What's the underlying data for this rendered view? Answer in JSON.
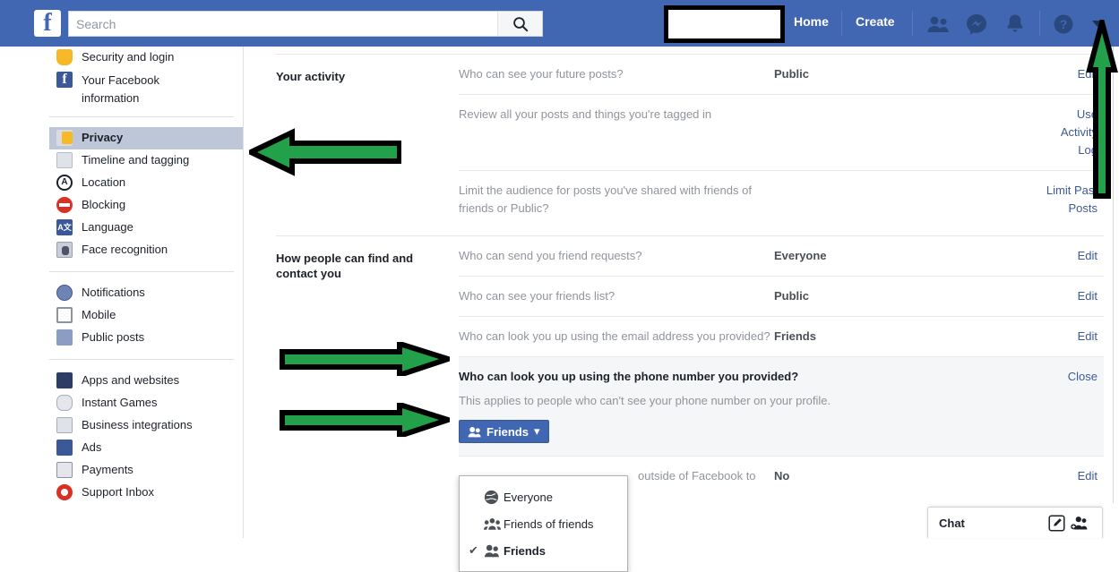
{
  "topbar": {
    "logo": "f",
    "search": {
      "placeholder": "Search",
      "value": "",
      "icon": "search-icon"
    },
    "redacted_account_name": "",
    "home_label": "Home",
    "create_label": "Create",
    "icons": [
      "friend-requests-icon",
      "messenger-icon",
      "notifications-icon",
      "help-icon",
      "account-menu-caret-icon"
    ],
    "brand_color": "#4267b2"
  },
  "sidebar": {
    "groups": [
      {
        "items": [
          {
            "label": "Security and login",
            "icon": "shield-icon",
            "active": false
          },
          {
            "label": "Your Facebook information",
            "icon": "facebook-icon",
            "active": false,
            "two_line": true
          }
        ]
      },
      {
        "items": [
          {
            "label": "Privacy",
            "icon": "lock-icon",
            "active": true
          },
          {
            "label": "Timeline and tagging",
            "icon": "timeline-icon",
            "active": false
          },
          {
            "label": "Location",
            "icon": "location-icon",
            "active": false
          },
          {
            "label": "Blocking",
            "icon": "block-icon",
            "active": false
          },
          {
            "label": "Language",
            "icon": "language-icon",
            "active": false
          },
          {
            "label": "Face recognition",
            "icon": "face-recognition-icon",
            "active": false
          }
        ]
      },
      {
        "items": [
          {
            "label": "Notifications",
            "icon": "globe-icon",
            "active": false
          },
          {
            "label": "Mobile",
            "icon": "mobile-icon",
            "active": false
          },
          {
            "label": "Public posts",
            "icon": "rss-icon",
            "active": false
          }
        ]
      },
      {
        "items": [
          {
            "label": "Apps and websites",
            "icon": "apps-icon",
            "active": false
          },
          {
            "label": "Instant Games",
            "icon": "gamepad-icon",
            "active": false
          },
          {
            "label": "Business integrations",
            "icon": "business-gear-icon",
            "active": false
          },
          {
            "label": "Ads",
            "icon": "ads-icon",
            "active": false
          },
          {
            "label": "Payments",
            "icon": "payments-card-icon",
            "active": false
          },
          {
            "label": "Support Inbox",
            "icon": "support-lifering-icon",
            "active": false
          }
        ]
      }
    ],
    "active_highlight_color": "#bdc7d8"
  },
  "main": {
    "sections": [
      {
        "title": "Your activity",
        "rows": [
          {
            "question": "Who can see your future posts?",
            "value": "Public",
            "action": "Edit"
          },
          {
            "question": "Review all your posts and things you're tagged in",
            "value": "",
            "action": "Use Activity Log"
          },
          {
            "question": "Limit the audience for posts you've shared with friends of friends or Public?",
            "value": "",
            "action": "Limit Past Posts"
          }
        ]
      },
      {
        "title": "How people can find and contact you",
        "rows": [
          {
            "question": "Who can send you friend requests?",
            "value": "Everyone",
            "action": "Edit"
          },
          {
            "question": "Who can see your friends list?",
            "value": "Public",
            "action": "Edit"
          },
          {
            "question": "Who can look you up using the email address you provided?",
            "value": "Friends",
            "action": "Edit"
          }
        ],
        "expanded_row": {
          "title": "Who can look you up using the phone number you provided?",
          "close_label": "Close",
          "subtitle": "This applies to people who can't see your phone number on your profile.",
          "audience_button": {
            "label": "Friends",
            "icon": "friends-icon",
            "caret": "▾"
          },
          "dropdown": {
            "options": [
              {
                "label": "Everyone",
                "icon": "globe-icon",
                "selected": false
              },
              {
                "label": "Friends of friends",
                "icon": "friends-of-friends-icon",
                "selected": false
              },
              {
                "label": "Friends",
                "icon": "friends-icon",
                "selected": true
              }
            ],
            "check_glyph": "✔"
          }
        },
        "trailing_row": {
          "question_visible_fragment": "outside of Facebook to",
          "value": "No",
          "action": "Edit"
        }
      }
    ]
  },
  "chatbar": {
    "label": "Chat",
    "icons": [
      "compose-icon",
      "add-friends-icon"
    ]
  },
  "annotations": {
    "color": "#22a04a",
    "outline": "#000000",
    "arrows": [
      {
        "name": "arrow-to-privacy",
        "direction": "left"
      },
      {
        "name": "arrow-to-phone-question",
        "direction": "right"
      },
      {
        "name": "arrow-to-audience-button",
        "direction": "right"
      },
      {
        "name": "arrow-to-account-menu",
        "direction": "up"
      }
    ]
  }
}
